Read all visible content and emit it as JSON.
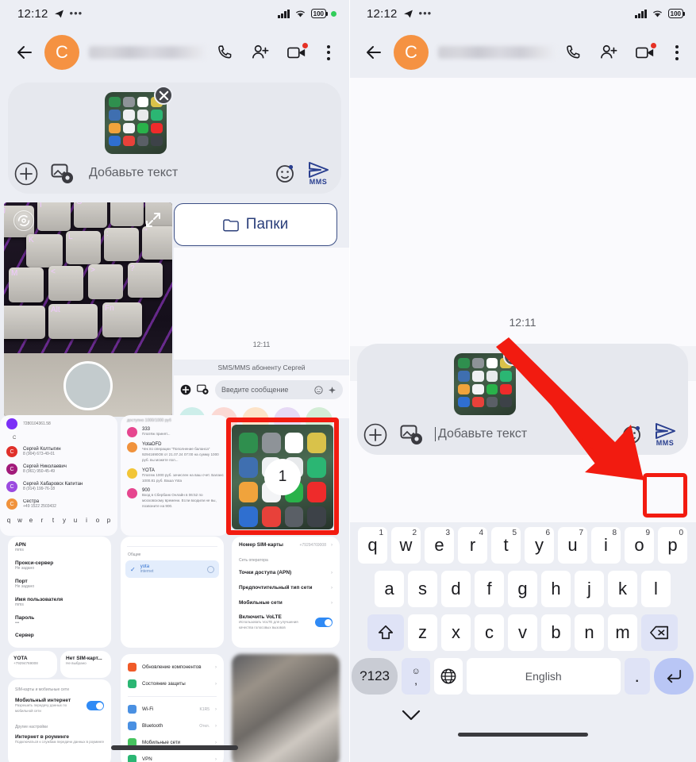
{
  "status_bar": {
    "time": "12:12",
    "battery_level": "100",
    "icons": [
      "telegram-icon",
      "more-dots-icon",
      "signal-bars-icon",
      "wifi-icon",
      "battery-icon",
      "green-dot-icon"
    ]
  },
  "app_bar": {
    "back_label": "←",
    "avatar_initial": "C",
    "contact_name_blurred": "",
    "actions": [
      "call-icon",
      "add-person-icon",
      "video-call-icon",
      "overflow-menu-icon"
    ]
  },
  "composer": {
    "placeholder": "Добавьте текст",
    "attachment_close_label": "×",
    "plus_label": "+",
    "send_label": "MMS",
    "icons": [
      "plus-icon",
      "camera-gallery-icon",
      "emoji-icon",
      "send-mms-icon",
      "close-attachment-icon"
    ]
  },
  "camera_panel": {
    "rotate_icon": "rotate-camera-icon",
    "expand_icon": "expand-icon",
    "shutter_label": ""
  },
  "folders_button": {
    "label": "Папки",
    "icon": "folder-icon"
  },
  "chat_fragment": {
    "timestamp": "12:11",
    "sms_band": "SMS/MMS абоненту Сергей",
    "input_placeholder": "Введите сообщение"
  },
  "contacts_card": {
    "section_letter": "С",
    "items": [
      {
        "name": "Сергей Колтыгин",
        "phone": "8 (904) 673-49-01",
        "color": "#e0302a"
      },
      {
        "name": "Сергей Николаевич",
        "phone": "8 (961) 950-45-49",
        "color": "#a21a7a"
      },
      {
        "name": "Сергей Хабаровск Капитан",
        "phone": "8 (914) 199-76-18",
        "color": "#9b4ae0"
      },
      {
        "name": "Сестра",
        "phone": "+49 1522 2503432",
        "color": "#f0923c"
      }
    ],
    "top_number": "7280104361.58"
  },
  "sms_card": {
    "header": "доступно 1000/1000 руб",
    "items": [
      {
        "sender": "333",
        "preview": "Платёж принят...",
        "color": "#e6468f"
      },
      {
        "sender": "YotaOFD",
        "preview": "Чек по операции \"Пополнение баланса\" 92941690O8 от 21.07.24 07:00 на сумму 1000 руб. вы можете пол...",
        "color": "#f0923c"
      },
      {
        "sender": "YOTA",
        "preview": "Платеж 1000 руб. зачислен на ваш счет. Баланс 1000.81 руб. Ваша Yota",
        "color": "#f2c537"
      },
      {
        "sender": "900",
        "preview": "Вход в Сбербанк Онлайн в 06:52 по московскому времени. Если входили не вы, позвоните на 900.",
        "color": "#e6468f"
      }
    ]
  },
  "selected_screenshot": {
    "badge": "1"
  },
  "apn_card": {
    "rows": [
      {
        "label": "APN",
        "value": "mms"
      },
      {
        "label": "Прокси-сервер",
        "value": "Не задано"
      },
      {
        "label": "Порт",
        "value": "Не задано"
      },
      {
        "label": "Имя пользователя",
        "value": "mms"
      },
      {
        "label": "Пароль",
        "value": "•••"
      },
      {
        "label": "Сервер",
        "value": ""
      }
    ],
    "footer": [
      {
        "label": "YOTA",
        "value": "+79294769008"
      },
      {
        "label": "Нет SIM-карт...",
        "value": "Не выбрано"
      }
    ]
  },
  "apn_list_card": {
    "section": "Общие",
    "selected": {
      "name": "yota",
      "sub": "internet"
    }
  },
  "sim_card_panel": {
    "rows": [
      {
        "label": "Номер SIM-карты",
        "value": "+79294769008"
      },
      {
        "label": "Точки доступа (APN)",
        "value": ""
      },
      {
        "label": "Предпочтительный тип сети",
        "value": ""
      },
      {
        "label": "Мобильные сети",
        "value": ""
      }
    ],
    "section_label": "Сеть оператора",
    "volte": {
      "label": "Включить VoLTE",
      "sub": "Использовать VoLTE для улучшения качества голосовых вызовов",
      "on": true
    }
  },
  "mobile_data_card": {
    "section": "SIM-карты и мобильные сети",
    "toggle": {
      "label": "Мобильный интернет",
      "sub": "Разрешить передачу данных по мобильной сети",
      "on": true
    },
    "other_section": "Другие настройки",
    "roaming": {
      "label": "Интернет в роуминге",
      "sub": "Подключаться к службам передачи данных в роуминге"
    }
  },
  "security_card": {
    "items": [
      {
        "label": "Обновление компонентов",
        "value": "",
        "color": "#f05a28"
      },
      {
        "label": "Состояние защиты",
        "value": "",
        "color": "#2bb673"
      },
      {
        "label": "Wi-Fi",
        "value": "K1R5",
        "color": "#4a90e2"
      },
      {
        "label": "Bluetooth",
        "value": "Откл.",
        "color": "#4a90e2"
      },
      {
        "label": "Мобильные сети",
        "value": "",
        "color": "#46c35f"
      },
      {
        "label": "VPN",
        "value": "",
        "color": "#2bb673"
      }
    ]
  },
  "keyboard": {
    "row1": [
      {
        "key": "q",
        "num": "1"
      },
      {
        "key": "w",
        "num": "2"
      },
      {
        "key": "e",
        "num": "3"
      },
      {
        "key": "r",
        "num": "4"
      },
      {
        "key": "t",
        "num": "5"
      },
      {
        "key": "y",
        "num": "6"
      },
      {
        "key": "u",
        "num": "7"
      },
      {
        "key": "i",
        "num": "8"
      },
      {
        "key": "o",
        "num": "9"
      },
      {
        "key": "p",
        "num": "0"
      }
    ],
    "row2": [
      "a",
      "s",
      "d",
      "f",
      "g",
      "h",
      "j",
      "k",
      "l"
    ],
    "row3": [
      "z",
      "x",
      "c",
      "v",
      "b",
      "n",
      "m"
    ],
    "shift_icon": "shift-icon",
    "backspace_icon": "backspace-icon",
    "symbols_label": "?123",
    "emoji_comma_label": ",",
    "globe_icon": "globe-icon",
    "space_label": "English",
    "period_label": ".",
    "enter_icon": "enter-icon",
    "dismiss_icon": "chevron-down-icon"
  },
  "annotations": {
    "highlight_color": "#f21b10",
    "arrow_color": "#f21b10"
  }
}
